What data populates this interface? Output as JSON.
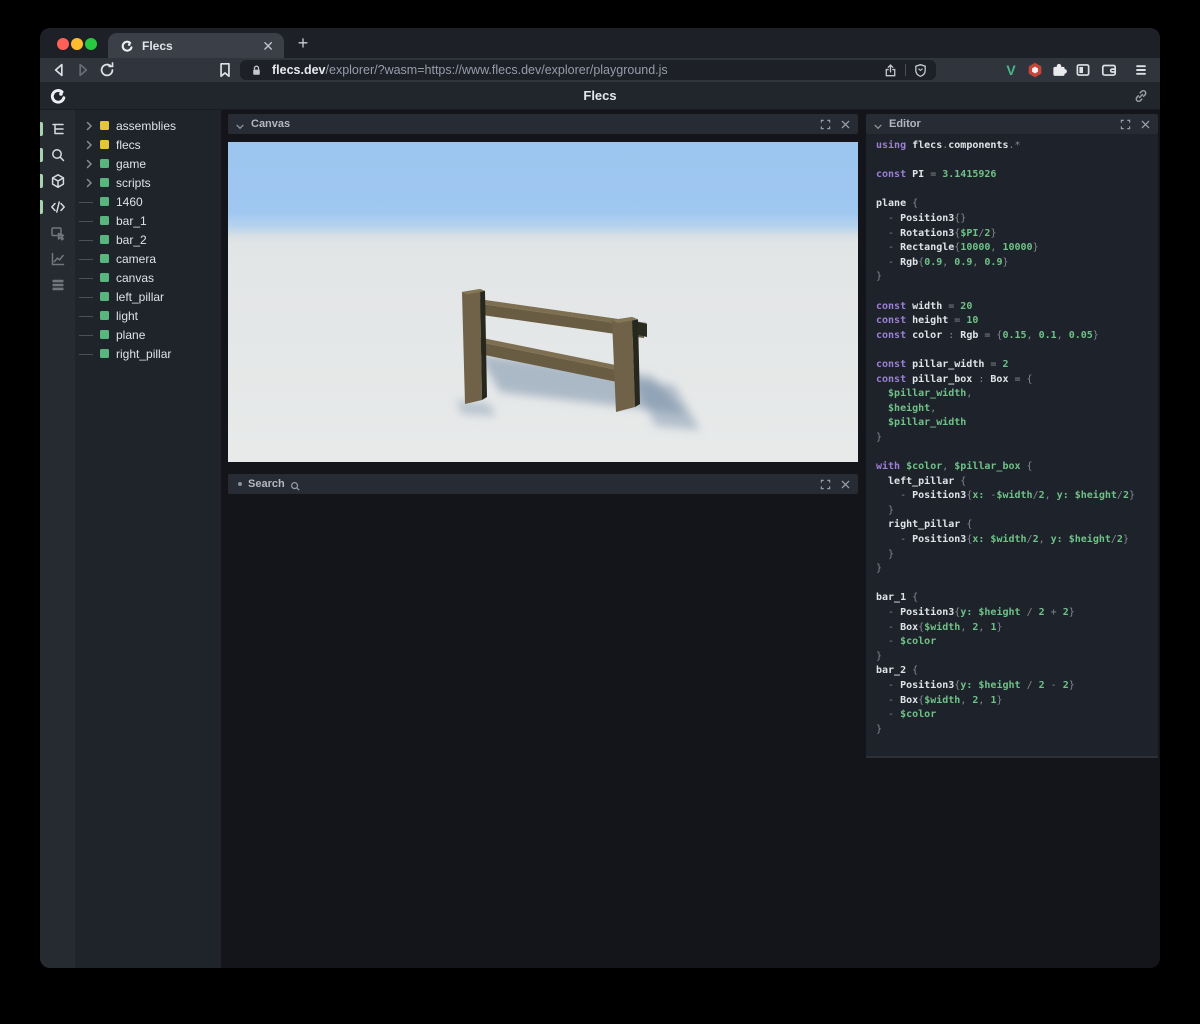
{
  "browser": {
    "tab_title": "Flecs",
    "new_tab_button": "+",
    "url_domain": "flecs.dev",
    "url_path": "/explorer/?wasm=https://www.flecs.dev/explorer/playground.js",
    "traffic_lights": [
      "#ff5f57",
      "#febc2e",
      "#28c840"
    ],
    "extension_v_label": "V",
    "extension_v_color": "#49b88a"
  },
  "header": {
    "title": "Flecs"
  },
  "sidebar": {
    "items": [
      {
        "icon": "tree-icon",
        "active": true
      },
      {
        "icon": "search-icon",
        "active": true
      },
      {
        "icon": "box-icon",
        "active": true
      },
      {
        "icon": "code-icon",
        "active": true
      },
      {
        "icon": "inspect-icon",
        "active": false
      },
      {
        "icon": "chart-icon",
        "active": false
      },
      {
        "icon": "rows-icon",
        "active": false
      }
    ]
  },
  "tree": {
    "items": [
      {
        "label": "assemblies",
        "expandable": true,
        "color": "#e4c33d"
      },
      {
        "label": "flecs",
        "expandable": true,
        "color": "#e4c33d"
      },
      {
        "label": "game",
        "expandable": true,
        "color": "#57b57d"
      },
      {
        "label": "scripts",
        "expandable": true,
        "color": "#57b57d"
      },
      {
        "label": "1460",
        "expandable": false,
        "color": "#57b57d"
      },
      {
        "label": "bar_1",
        "expandable": false,
        "color": "#57b57d"
      },
      {
        "label": "bar_2",
        "expandable": false,
        "color": "#57b57d"
      },
      {
        "label": "camera",
        "expandable": false,
        "color": "#57b57d"
      },
      {
        "label": "canvas",
        "expandable": false,
        "color": "#57b57d"
      },
      {
        "label": "left_pillar",
        "expandable": false,
        "color": "#57b57d"
      },
      {
        "label": "light",
        "expandable": false,
        "color": "#57b57d"
      },
      {
        "label": "plane",
        "expandable": false,
        "color": "#57b57d"
      },
      {
        "label": "right_pillar",
        "expandable": false,
        "color": "#57b57d"
      }
    ]
  },
  "panels": {
    "canvas_title": "Canvas",
    "search_title": "Search",
    "editor_title": "Editor"
  },
  "scene": {
    "sky_top": "#9cc5ef",
    "sky_horizon": "#d8e0e4",
    "ground": "#e7e9e9",
    "wood_lit": "#6f6248",
    "wood_front": "#685c43",
    "wood_top": "#7d6f50",
    "wood_dark": "#26281e",
    "shadow": "#7289a4"
  },
  "editor": {
    "lines": [
      [
        [
          "k",
          "using "
        ],
        [
          "n",
          "flecs"
        ],
        [
          "p",
          "."
        ],
        [
          "n",
          "components"
        ],
        [
          "p",
          ".*"
        ]
      ],
      [],
      [
        [
          "k",
          "const "
        ],
        [
          "n",
          "PI"
        ],
        [
          "p",
          " = "
        ],
        [
          "g",
          "3.1415926"
        ]
      ],
      [],
      [
        [
          "n",
          "plane"
        ],
        [
          "p",
          " {"
        ]
      ],
      [
        [
          "p",
          "  - "
        ],
        [
          "n",
          "Position3"
        ],
        [
          "p",
          "{}"
        ]
      ],
      [
        [
          "p",
          "  - "
        ],
        [
          "n",
          "Rotation3"
        ],
        [
          "p",
          "{"
        ],
        [
          "g",
          "$PI"
        ],
        [
          "p",
          "/"
        ],
        [
          "g",
          "2"
        ],
        [
          "p",
          "}"
        ]
      ],
      [
        [
          "p",
          "  - "
        ],
        [
          "n",
          "Rectangle"
        ],
        [
          "p",
          "{"
        ],
        [
          "g",
          "10000"
        ],
        [
          "p",
          ", "
        ],
        [
          "g",
          "10000"
        ],
        [
          "p",
          "}"
        ]
      ],
      [
        [
          "p",
          "  - "
        ],
        [
          "n",
          "Rgb"
        ],
        [
          "p",
          "{"
        ],
        [
          "g",
          "0.9"
        ],
        [
          "p",
          ", "
        ],
        [
          "g",
          "0.9"
        ],
        [
          "p",
          ", "
        ],
        [
          "g",
          "0.9"
        ],
        [
          "p",
          "}"
        ]
      ],
      [
        [
          "p",
          "}"
        ]
      ],
      [],
      [
        [
          "k",
          "const "
        ],
        [
          "n",
          "width"
        ],
        [
          "p",
          " = "
        ],
        [
          "g",
          "20"
        ]
      ],
      [
        [
          "k",
          "const "
        ],
        [
          "n",
          "height"
        ],
        [
          "p",
          " = "
        ],
        [
          "g",
          "10"
        ]
      ],
      [
        [
          "k",
          "const "
        ],
        [
          "n",
          "color"
        ],
        [
          "p",
          " : "
        ],
        [
          "n",
          "Rgb"
        ],
        [
          "p",
          " = {"
        ],
        [
          "g",
          "0.15"
        ],
        [
          "p",
          ", "
        ],
        [
          "g",
          "0.1"
        ],
        [
          "p",
          ", "
        ],
        [
          "g",
          "0.05"
        ],
        [
          "p",
          "}"
        ]
      ],
      [],
      [
        [
          "k",
          "const "
        ],
        [
          "n",
          "pillar_width"
        ],
        [
          "p",
          " = "
        ],
        [
          "g",
          "2"
        ]
      ],
      [
        [
          "k",
          "const "
        ],
        [
          "n",
          "pillar_box"
        ],
        [
          "p",
          " : "
        ],
        [
          "n",
          "Box"
        ],
        [
          "p",
          " = {"
        ]
      ],
      [
        [
          "g",
          "  $pillar_width"
        ],
        [
          "p",
          ","
        ]
      ],
      [
        [
          "g",
          "  $height"
        ],
        [
          "p",
          ","
        ]
      ],
      [
        [
          "g",
          "  $pillar_width"
        ]
      ],
      [
        [
          "p",
          "}"
        ]
      ],
      [],
      [
        [
          "k",
          "with "
        ],
        [
          "g",
          "$color"
        ],
        [
          "p",
          ", "
        ],
        [
          "g",
          "$pillar_box"
        ],
        [
          "p",
          " {"
        ]
      ],
      [
        [
          "n",
          "  left_pillar"
        ],
        [
          "p",
          " {"
        ]
      ],
      [
        [
          "p",
          "    - "
        ],
        [
          "n",
          "Position3"
        ],
        [
          "p",
          "{"
        ],
        [
          "g",
          "x:"
        ],
        [
          "p",
          " -"
        ],
        [
          "g",
          "$width"
        ],
        [
          "p",
          "/"
        ],
        [
          "g",
          "2"
        ],
        [
          "p",
          ", "
        ],
        [
          "g",
          "y:"
        ],
        [
          "p",
          " "
        ],
        [
          "g",
          "$height"
        ],
        [
          "p",
          "/"
        ],
        [
          "g",
          "2"
        ],
        [
          "p",
          "}"
        ]
      ],
      [
        [
          "p",
          "  }"
        ]
      ],
      [
        [
          "n",
          "  right_pillar"
        ],
        [
          "p",
          " {"
        ]
      ],
      [
        [
          "p",
          "    - "
        ],
        [
          "n",
          "Position3"
        ],
        [
          "p",
          "{"
        ],
        [
          "g",
          "x:"
        ],
        [
          "p",
          " "
        ],
        [
          "g",
          "$width"
        ],
        [
          "p",
          "/"
        ],
        [
          "g",
          "2"
        ],
        [
          "p",
          ", "
        ],
        [
          "g",
          "y:"
        ],
        [
          "p",
          " "
        ],
        [
          "g",
          "$height"
        ],
        [
          "p",
          "/"
        ],
        [
          "g",
          "2"
        ],
        [
          "p",
          "}"
        ]
      ],
      [
        [
          "p",
          "  }"
        ]
      ],
      [
        [
          "p",
          "}"
        ]
      ],
      [],
      [
        [
          "n",
          "bar_1"
        ],
        [
          "p",
          " {"
        ]
      ],
      [
        [
          "p",
          "  - "
        ],
        [
          "n",
          "Position3"
        ],
        [
          "p",
          "{"
        ],
        [
          "g",
          "y:"
        ],
        [
          "p",
          " "
        ],
        [
          "g",
          "$height"
        ],
        [
          "p",
          " / "
        ],
        [
          "g",
          "2"
        ],
        [
          "p",
          " + "
        ],
        [
          "g",
          "2"
        ],
        [
          "p",
          "}"
        ]
      ],
      [
        [
          "p",
          "  - "
        ],
        [
          "n",
          "Box"
        ],
        [
          "p",
          "{"
        ],
        [
          "g",
          "$width"
        ],
        [
          "p",
          ", "
        ],
        [
          "g",
          "2"
        ],
        [
          "p",
          ", "
        ],
        [
          "g",
          "1"
        ],
        [
          "p",
          "}"
        ]
      ],
      [
        [
          "p",
          "  - "
        ],
        [
          "g",
          "$color"
        ]
      ],
      [
        [
          "p",
          "}"
        ]
      ],
      [
        [
          "n",
          "bar_2"
        ],
        [
          "p",
          " {"
        ]
      ],
      [
        [
          "p",
          "  - "
        ],
        [
          "n",
          "Position3"
        ],
        [
          "p",
          "{"
        ],
        [
          "g",
          "y:"
        ],
        [
          "p",
          " "
        ],
        [
          "g",
          "$height"
        ],
        [
          "p",
          " / "
        ],
        [
          "g",
          "2"
        ],
        [
          "p",
          " - "
        ],
        [
          "g",
          "2"
        ],
        [
          "p",
          "}"
        ]
      ],
      [
        [
          "p",
          "  - "
        ],
        [
          "n",
          "Box"
        ],
        [
          "p",
          "{"
        ],
        [
          "g",
          "$width"
        ],
        [
          "p",
          ", "
        ],
        [
          "g",
          "2"
        ],
        [
          "p",
          ", "
        ],
        [
          "g",
          "1"
        ],
        [
          "p",
          "}"
        ]
      ],
      [
        [
          "p",
          "  - "
        ],
        [
          "g",
          "$color"
        ]
      ],
      [
        [
          "p",
          "}"
        ]
      ]
    ]
  }
}
